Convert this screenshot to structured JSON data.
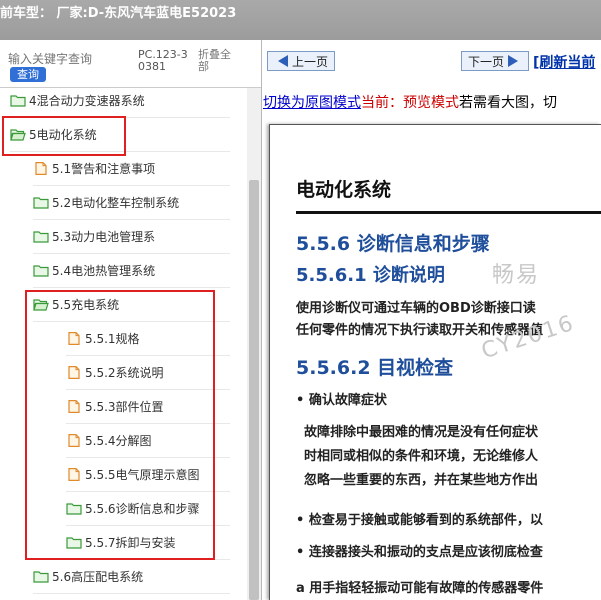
{
  "titlebar": {
    "text": "前车型： 厂家:D-东风汽车蓝电E52023"
  },
  "left": {
    "search_placeholder": "输入关键字查询",
    "search_button": "查询",
    "pc_text": "PC.123-30381",
    "fold_text": "折叠全部",
    "tree": [
      {
        "label": "4混合动力变速器系统",
        "icon": "folder-icon"
      },
      {
        "label": "5电动化系统",
        "icon": "folder-open-icon"
      },
      {
        "label": "5.1警告和注意事项",
        "icon": "document-icon"
      },
      {
        "label": "5.2电动化整车控制系统",
        "icon": "folder-icon"
      },
      {
        "label": "5.3动力电池管理系",
        "icon": "folder-icon"
      },
      {
        "label": "5.4电池热管理系统",
        "icon": "folder-icon"
      },
      {
        "label": "5.5充电系统",
        "icon": "folder-open-icon"
      },
      {
        "label": "5.5.1规格",
        "icon": "document-icon"
      },
      {
        "label": "5.5.2系统说明",
        "icon": "document-icon"
      },
      {
        "label": "5.5.3部件位置",
        "icon": "document-icon"
      },
      {
        "label": "5.5.4分解图",
        "icon": "document-icon"
      },
      {
        "label": "5.5.5电气原理示意图",
        "icon": "document-icon"
      },
      {
        "label": "5.5.6诊断信息和步骤",
        "icon": "folder-icon"
      },
      {
        "label": "5.5.7拆卸与安装",
        "icon": "folder-icon"
      },
      {
        "label": "5.6高压配电系统",
        "icon": "folder-icon"
      }
    ]
  },
  "right": {
    "prev_label": "上一页",
    "next_label": "下一页",
    "refresh_label": "[刷新当前",
    "switch_link": "切换为原图模式",
    "current_label": "当前：",
    "mode_label": "预览模式",
    "hint_text": "若需看大图，切",
    "doc": {
      "section_title": "电动化系统",
      "heading_1": "5.5.6 诊断信息和步骤",
      "heading_2": "5.5.6.1 诊断说明",
      "para_1_line_1": "使用诊断仪可通过车辆的OBD诊断接口读",
      "para_1_line_2": "任何零件的情况下执行读取开关和传感器值",
      "heading_3": "5.5.6.2 目视检查",
      "bullet_1": "• 确认故障症状",
      "para_2_line_1": "故障排除中最困难的情况是没有任何症状",
      "para_2_line_2": "时相同或相似的条件和环境，无论维修人",
      "para_2_line_3": "忽略一些重要的东西，并在某些地方作出",
      "bullet_2": "• 检查易于接触或能够看到的系统部件，以",
      "bullet_3": "• 连接器接头和振动的支点是应该彻底检查",
      "para_3": "a 用手指轻轻振动可能有故障的传感器零件",
      "watermark_1": "畅易",
      "watermark_2": "CY2016"
    }
  },
  "colors": {
    "highlight_box": "#e02020",
    "heading_blue": "#1f4e9b",
    "link_blue": "#0000cc"
  }
}
